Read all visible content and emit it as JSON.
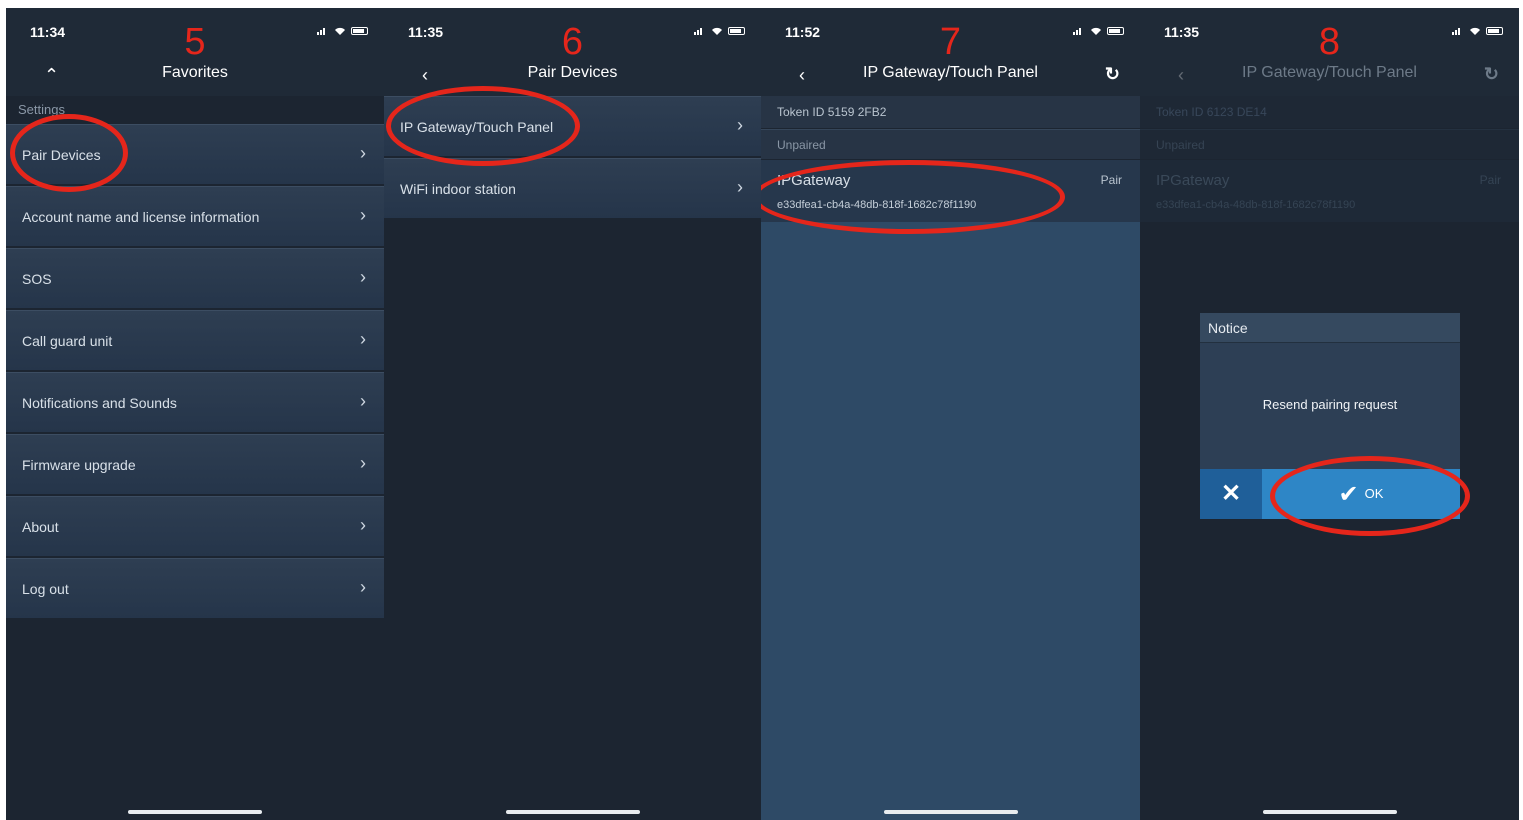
{
  "panels": [
    {
      "step": "5",
      "time": "11:34",
      "title": "Favorites",
      "section": "Settings",
      "items": [
        "Pair Devices",
        "Account name and license information",
        "SOS",
        "Call guard unit",
        "Notifications and Sounds",
        "Firmware upgrade",
        "About",
        "Log out"
      ]
    },
    {
      "step": "6",
      "time": "11:35",
      "title": "Pair Devices",
      "items": [
        "IP Gateway/Touch Panel",
        "WiFi indoor station"
      ]
    },
    {
      "step": "7",
      "time": "11:52",
      "title": "IP Gateway/Touch Panel",
      "token": "Token ID 5159 2FB2",
      "status": "Unpaired",
      "device_name": "IPGateway",
      "device_id": "e33dfea1-cb4a-48db-818f-1682c78f1190",
      "pair_label": "Pair"
    },
    {
      "step": "8",
      "time": "11:35",
      "title": "IP Gateway/Touch Panel",
      "token": "Token ID 6123 DE14",
      "status": "Unpaired",
      "device_name": "IPGateway",
      "device_id": "e33dfea1-cb4a-48db-818f-1682c78f1190",
      "pair_label": "Pair",
      "dialog": {
        "title": "Notice",
        "message": "Resend pairing request",
        "ok_label": "OK"
      }
    }
  ],
  "icons": {
    "chevron_right": "›",
    "chevron_left": "‹",
    "chevron_up": "⌃",
    "refresh": "↻",
    "close": "✕",
    "check": "✔"
  },
  "colors": {
    "annotation": "#e5261b",
    "background": "#1c2531",
    "ok_button": "#2e86c6"
  }
}
